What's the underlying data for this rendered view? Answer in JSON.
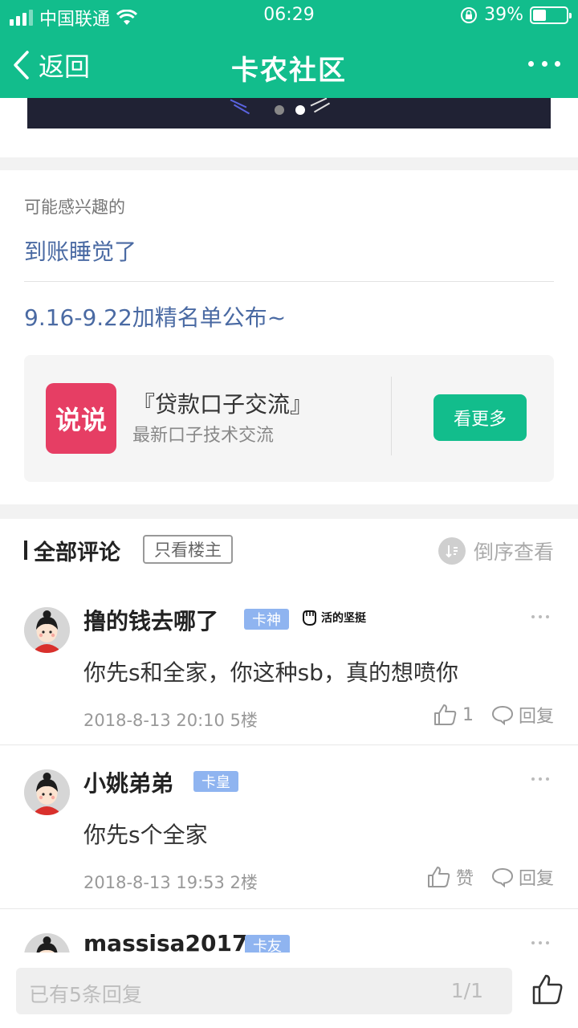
{
  "status_bar": {
    "carrier": "中国联通",
    "time": "06:29",
    "battery": "39%"
  },
  "nav": {
    "back_label": "返回",
    "title": "卡农社区"
  },
  "interest": {
    "label": "可能感兴趣的",
    "links": [
      "到账睡觉了",
      "9.16-9.22加精名单公布~"
    ]
  },
  "circle": {
    "logo_text": "说说",
    "name": "『贷款口子交流』",
    "desc": "最新口子技术交流",
    "button": "看更多"
  },
  "comments_header": {
    "title": "全部评论",
    "op_only": "只看楼主",
    "sort": "倒序查看"
  },
  "comments": [
    {
      "user": "撸的钱去哪了",
      "badge": "卡神",
      "medal": "活的坚挺",
      "text": "你先s和全家，你这种sb，真的想喷你",
      "meta": "2018-8-13 20:10  5楼",
      "likes": "1",
      "reply": "回复"
    },
    {
      "user": "小姚弟弟",
      "badge": "卡皇",
      "text": "你先s个全家",
      "meta": "2018-8-13 19:53  2楼",
      "likes": "赞",
      "reply": "回复"
    },
    {
      "user": "massisa2017",
      "badge": "卡友"
    }
  ],
  "bottom": {
    "placeholder": "已有5条回复",
    "page": "1/1"
  },
  "colors": {
    "brand": "#12bd8c",
    "link": "#4a6aa3",
    "badge": "#8fb4f0",
    "logo": "#e63e64"
  }
}
